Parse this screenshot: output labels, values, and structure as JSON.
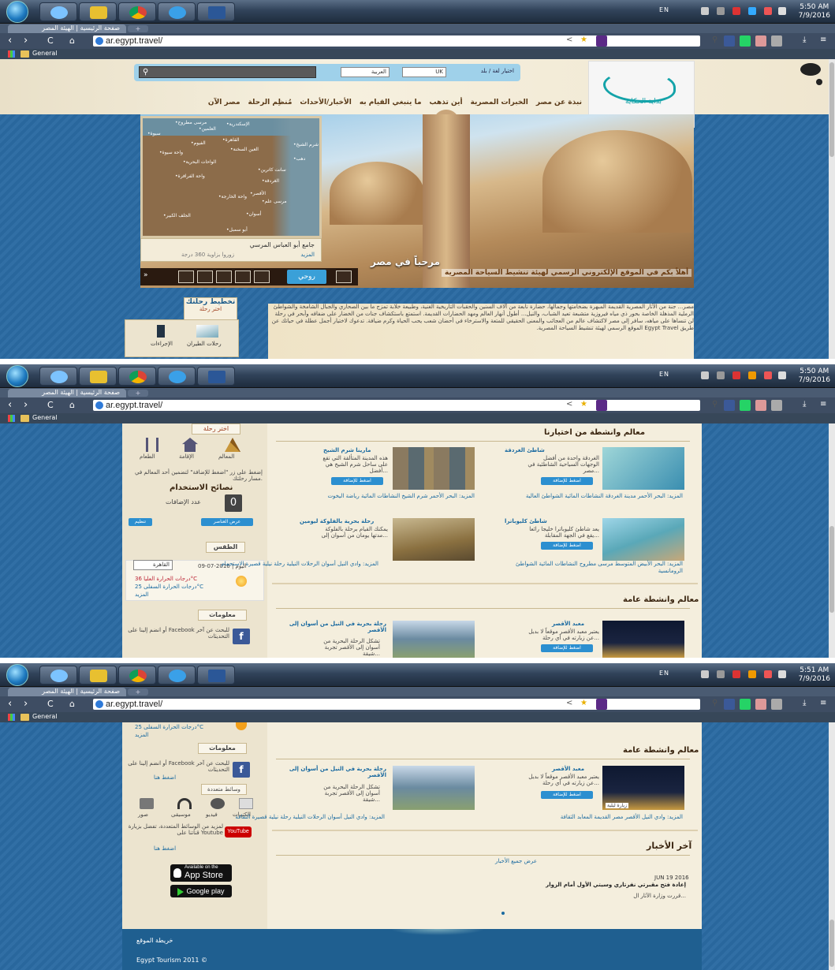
{
  "browser": {
    "tab_title": "صفحة الرئيسية | الهيئة المصر",
    "new_tab": "+",
    "url": "ar.egypt.travel/",
    "bookmarks_folder": "General",
    "tray_lang": "EN",
    "clock_1_time": "5:50 AM",
    "clock_2_time": "5:50 AM",
    "clock_3_time": "5:51 AM",
    "clock_date": "7/9/2016"
  },
  "header": {
    "country_language_label": "اختيار لغة / بلد",
    "country_value": "UK",
    "language_value": "العربية",
    "logo_text": "بداية الحكاية",
    "nav": [
      "نبذة عن مصر",
      "الخبرات المصرية",
      "أين تذهب",
      "ما ينبغي القيام به",
      "الأخبار/الأحداث",
      "مُنظِم الرحلة",
      "مصر الآن"
    ]
  },
  "map": {
    "places": [
      {
        "name": "الإسكندرية"
      },
      {
        "name": "مرسى مطروح"
      },
      {
        "name": "العلمين"
      },
      {
        "name": "سيوة"
      },
      {
        "name": "القاهرة"
      },
      {
        "name": "الفيوم"
      },
      {
        "name": "العين السخنة"
      },
      {
        "name": "واحة سيوة"
      },
      {
        "name": "الواحات البحرية"
      },
      {
        "name": "سانت كاترين"
      },
      {
        "name": "شرم الشيخ"
      },
      {
        "name": "الغردقة"
      },
      {
        "name": "واحة الفرافرة"
      },
      {
        "name": "الأقصر"
      },
      {
        "name": "مرسى علم"
      },
      {
        "name": "واحة الخارجة"
      },
      {
        "name": "أسوان"
      },
      {
        "name": "الجلف الكبير"
      },
      {
        "name": "أبو سمبل"
      },
      {
        "name": "دهب"
      }
    ],
    "caption_title": "جامع أبو العباس المرسي",
    "caption_more": "المزيد",
    "caption_360": "زوروا بزاوية 360 درجة"
  },
  "hero": {
    "filter_active": "روحي",
    "title": "مرحباً في مصر",
    "subtitle": "أهلاً بكم في الموقع الإلكتروني الرسمي لهيئة تنشيط السياحة المصرية"
  },
  "trip": {
    "title": "تخطيط رحلتك",
    "select": "اختر رحلة"
  },
  "tools": {
    "flights": "رحلات الطيران",
    "visas": "الإجراءات"
  },
  "intro_text": "مصر... جنة من الآثار المصرية القديمة المبهرة بضخامتها وجمالها، حضارة نابعة من آلاف السنين والحقبات التاريخية الغنية، وطبيعة خلابة تمزج ما بين الصحاري والجبال الشامخة والشواطئ الرملية المذهلة الخاصة بحور ذي مياه فيروزية متشبعة تعيد الشباب، والنيل... أطول أنهار العالم ومهد الحضارات القديمة. استمتع باستكشاف جنات من الخضار على ضفافه وأبحر في رحلة لن تنساها على مياهه، سافر إلى مصر لاكتشاف عالم من العجائب والمعنى الحقيقي للمتعة والاسترخاء في أحضان شعب يحب الحياة وكرم ضيافة. تدعوك لاختيار أجمل عطلة في حياتك عن طريق Egypt Travel الموقع الرسمي لهيئة تنشيط السياحة المصرية.",
  "sidebar": {
    "trip_select": "اختر رحلة",
    "cats": [
      "المعالم",
      "الإقامة",
      "الطعام"
    ],
    "add_hint": "إضغط على زر \"اضغط للإضافة\" لتضمين أحد المعالم في مسار رحلتك.",
    "tips_title": "نصائح الاستخدام",
    "count_label": "عدد الإضافات",
    "count_value": "0",
    "show_selected": "عرض العناصر",
    "organize": "تنظيم",
    "weather_title": "الطقس",
    "weather_day": "اليوم | 2016-07-09",
    "weather_city": "القاهرة",
    "weather_high": "درجات الحرارة العليا 36°C",
    "weather_low": "درجات الحرارة السفلى 25°C",
    "weather_more": "المزيد",
    "info_title": "معلومات",
    "facebook_text": "أو انضم إلينا على Facebook للبحث عن آخر التحديثات",
    "facebook_link": "اضغط هنا",
    "media_tab": "وسائط متعددة",
    "media": [
      "الكتيبات",
      "فيديو",
      "موسيقى",
      "صور"
    ],
    "youtube_text": "لمزيد من الوسائط المتعددة، تفضل بزيارة قناتنا على Youtube",
    "youtube_link": "اضغط هنا",
    "youtube_label": "YouTube",
    "appstore": "App Store",
    "appstore_small": "Available on the",
    "googleplay": "Google play"
  },
  "featured": {
    "title": "معالم وانشطة من اختيارنا",
    "add_btn": "اضغط للإضافة",
    "cards": [
      {
        "title": "شاطئ الغردقة",
        "desc": "الغردقة واحدة من أفضل الوجهات السياحية الشاطئية في مصر...",
        "tags": "المزيد: البحر الأحمر مدينة الغردقة النشاطات المائية الشواطئ العالية",
        "color": "#3a8eb0"
      },
      {
        "title": "مارينا شرم الشيخ",
        "desc": "هذه المدينة المتألقة التي تقع على ساحل شرم الشيخ هي أفضل...",
        "tags": "المزيد: البحر الأحمر شرم الشيخ النشاطات المائية رياضة اليخوت",
        "color": "#6d6a58"
      },
      {
        "title": "شاطئ كليوباترا",
        "desc": "يعد شاطئ كليوباترا خليجا رائعا يقع في الجهة المقابلة...",
        "tags": "المزيد: البحر الأبيض المتوسط مرسى مطروح النشاطات المائية الشواطئ الرومانسية",
        "color": "#5aa8b8"
      },
      {
        "title": "رحلة بحرية بالفلوكة ليومين",
        "desc": "يمكنك القيام برحلة بالفلوكة مدتها يومان من أسوان إلى...",
        "tags": "المزيد: وادي النيل أسوان الرحلات النيلية رحلة نيلية قصيرة الاستجمام",
        "color": "#8a7040"
      }
    ]
  },
  "general": {
    "title": "معالم وانشطة عامة",
    "cards": [
      {
        "title": "معبد الأقصر",
        "desc": "يعتبر معبد الأقصر موقعاً لا بديل عن زيارته في أي رحلة...",
        "tags": "المزيد: وادي النيل الأقصر مصر القديمة المعابد الثقافة",
        "img_caption": "زيارة ليلية",
        "color": "#1a2440"
      },
      {
        "title": "رحلة بحرية في النيل من أسوان إلى الأقصر",
        "desc": "تشكل الرحلة البحرية من أسوان إلى الأقصر تجربة شيقة...",
        "tags": "المزيد: وادي النيل أسوان الرحلات النيلية رحلة نيلية قصيرة الثقافة",
        "color": "#6a8aa0"
      }
    ]
  },
  "news": {
    "title": "آخر الأخبار",
    "all_link": "عرض جميع الأخبار",
    "date": "JUN 19 2016",
    "headline": "إعادة فتح مقبرتي نفرتاري وسيتي الأول أمام الزوار",
    "snippet": "قررت وزارة الآثار ال..."
  },
  "footer": {
    "sitemap": "خريطة الموقع",
    "copyright": "Egypt Tourism 2011 ©"
  },
  "colors": {
    "accent": "#2c8fd0",
    "brand_teal": "#14a3a9",
    "page_blue": "#2a6aa2"
  }
}
